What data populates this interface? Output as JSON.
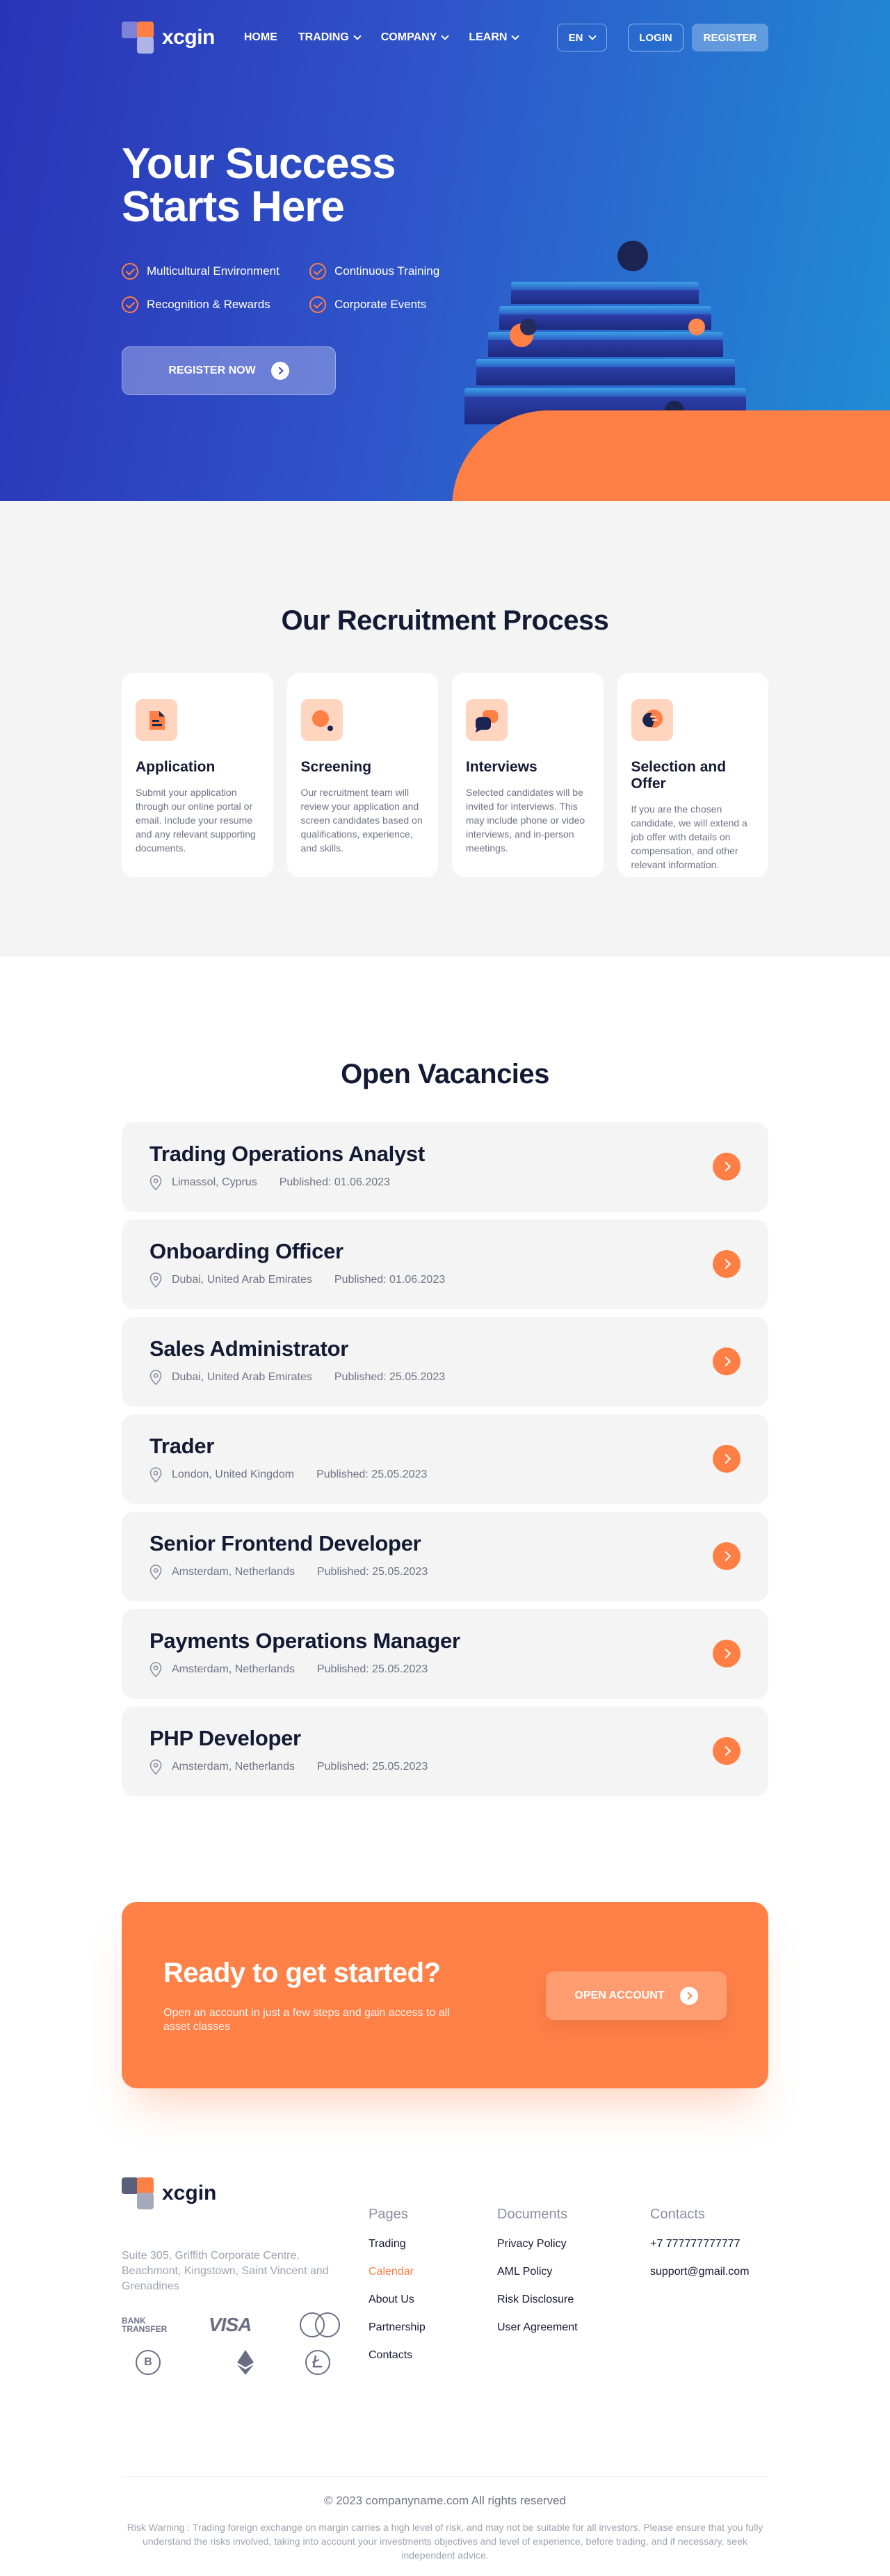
{
  "brand": {
    "name": "xcgin"
  },
  "nav": {
    "items": [
      {
        "label": "HOME",
        "dropdown": false
      },
      {
        "label": "TRADING",
        "dropdown": true
      },
      {
        "label": "COMPANY",
        "dropdown": true
      },
      {
        "label": "LEARN",
        "dropdown": true
      }
    ],
    "language": "EN",
    "login_label": "LOGIN",
    "register_label": "REGISTER"
  },
  "hero": {
    "title_line1": "Your Success",
    "title_line2": "Starts Here",
    "features": [
      "Multicultural Environment",
      "Continuous Training",
      "Recognition & Rewards",
      "Corporate Events"
    ],
    "cta_label": "REGISTER NOW"
  },
  "recruitment": {
    "title": "Our Recruitment Process",
    "steps": [
      {
        "icon": "document-icon",
        "title": "Application",
        "text": "Submit your application through our online portal or email. Include your resume and any relevant supporting documents."
      },
      {
        "icon": "magnifier-icon",
        "title": "Screening",
        "text": "Our recruitment team will review your application and screen candidates based on qualifications, experience, and skills."
      },
      {
        "icon": "chat-bubbles-icon",
        "title": "Interviews",
        "text": "Selected candidates will be invited for interviews. This may include phone or video interviews, and in-person meetings."
      },
      {
        "icon": "handshake-icon",
        "title": "Selection and Offer",
        "text": "If you are the chosen candidate, we will extend a job offer with details on compensation, and other relevant information."
      }
    ]
  },
  "vacancies": {
    "title": "Open Vacancies",
    "items": [
      {
        "title": "Trading Operations Analyst",
        "location": "Limassol, Cyprus",
        "published": "Published: 01.06.2023"
      },
      {
        "title": "Onboarding Officer",
        "location": "Dubai, United Arab Emirates",
        "published": "Published: 01.06.2023"
      },
      {
        "title": "Sales Administrator",
        "location": "Dubai, United Arab Emirates",
        "published": "Published: 25.05.2023"
      },
      {
        "title": "Trader",
        "location": "London, United Kingdom",
        "published": "Published: 25.05.2023"
      },
      {
        "title": "Senior Frontend Developer",
        "location": "Amsterdam, Netherlands",
        "published": "Published: 25.05.2023"
      },
      {
        "title": "Payments Operations Manager",
        "location": "Amsterdam, Netherlands",
        "published": "Published: 25.05.2023"
      },
      {
        "title": "PHP Developer",
        "location": "Amsterdam, Netherlands",
        "published": "Published: 25.05.2023"
      }
    ]
  },
  "cta": {
    "title": "Ready to get started?",
    "text": "Open an account in just a few steps and gain access to all asset classes",
    "button_label": "OPEN ACCOUNT"
  },
  "footer": {
    "address": "Suite 305, Griffith Corporate Centre, Beachmont, Kingstown, Saint Vincent and Grenadines",
    "payments": {
      "bank_line1": "BANK",
      "bank_line2": "TRANSFER",
      "visa": "VISA",
      "mastercard": "MasterCard",
      "bitcoin": "B"
    },
    "columns": [
      {
        "heading": "Pages",
        "links": [
          {
            "label": "Trading",
            "active": false
          },
          {
            "label": "Calendar",
            "active": true
          },
          {
            "label": "About Us",
            "active": false
          },
          {
            "label": "Partnership",
            "active": false
          },
          {
            "label": "Contacts",
            "active": false
          }
        ]
      },
      {
        "heading": "Documents",
        "links": [
          {
            "label": "Privacy Policy",
            "active": false
          },
          {
            "label": "AML Policy",
            "active": false
          },
          {
            "label": "Risk Disclosure",
            "active": false
          },
          {
            "label": "User Agreement",
            "active": false
          }
        ]
      },
      {
        "heading": "Contacts",
        "links": [
          {
            "label": "+7 777777777777",
            "active": false
          },
          {
            "label": "support@gmail.com",
            "active": false
          }
        ]
      }
    ],
    "copyright": "© 2023 companyname.com All rights reserved",
    "risk_warning": "Risk Warning : Trading foreign exchange on margin carries a high level of risk, and may not be suitable for all investors. Please ensure that you fully understand the risks involved, taking into account your investments objectives and level of experience, before trading, and if necessary, seek independent advice."
  },
  "colors": {
    "accent": "#ff7f45",
    "hero_start": "#2a34b6",
    "hero_end": "#1f8ed6",
    "dark_text": "#141a33",
    "muted_text": "#6f7486",
    "section_bg": "#f4f4f4"
  }
}
